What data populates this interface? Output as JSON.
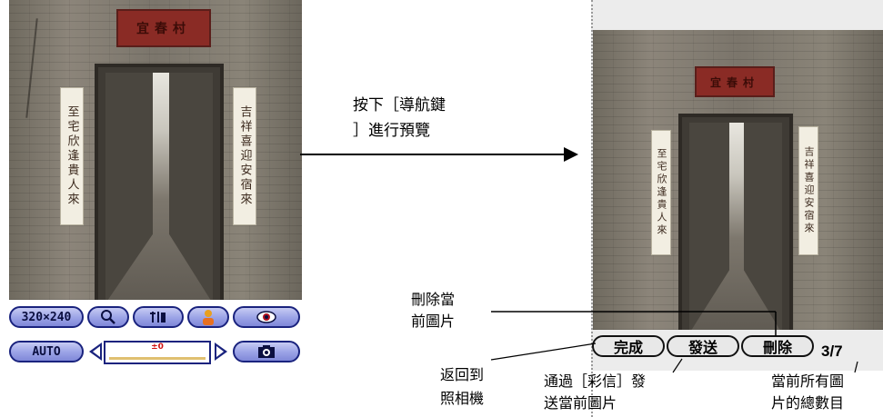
{
  "left_photo": {
    "plaque_text": "宜春村",
    "couplet_left": "至宅欣逢貴人來",
    "couplet_right": "吉祥喜迎安宿來"
  },
  "toolbar": {
    "resolution_label": "320×240",
    "auto_label": "AUTO",
    "exposure_value": "±0"
  },
  "arrow_caption": {
    "line1": "按下［導航鍵",
    "line2": "］進行預覽"
  },
  "preview": {
    "done_label": "完成",
    "send_label": "發送",
    "delete_label": "刪除",
    "counter": "3/7"
  },
  "callouts": {
    "delete": {
      "line1": "刪除當",
      "line2": "前圖片"
    },
    "done": {
      "line1": "返回到",
      "line2": "照相機"
    },
    "send": {
      "line1": "通過［彩信］發",
      "line2": "送當前圖片"
    },
    "counter": {
      "line1": "當前所有圖",
      "line2": "片的總數目"
    }
  }
}
